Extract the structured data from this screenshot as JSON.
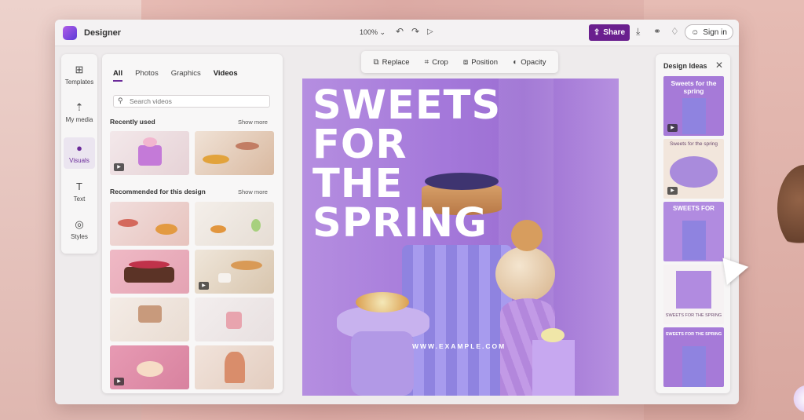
{
  "app": {
    "title": "Designer"
  },
  "titlebar": {
    "zoom": "100%",
    "share_label": "Share",
    "signin_label": "Sign in"
  },
  "rail": {
    "items": [
      {
        "label": "Templates"
      },
      {
        "label": "My media"
      },
      {
        "label": "Visuals",
        "active": true
      },
      {
        "label": "Text"
      },
      {
        "label": "Styles"
      }
    ]
  },
  "panel": {
    "tabs": [
      {
        "label": "All"
      },
      {
        "label": "Photos"
      },
      {
        "label": "Graphics"
      },
      {
        "label": "Videos"
      }
    ],
    "search_placeholder": "Search videos",
    "recent_title": "Recently used",
    "recent_more": "Show more",
    "recommended_title": "Recommended for this design",
    "recommended_more": "Show more"
  },
  "toolbar": {
    "items": [
      {
        "label": "Replace"
      },
      {
        "label": "Crop"
      },
      {
        "label": "Position"
      },
      {
        "label": "Opacity"
      }
    ]
  },
  "canvas": {
    "title_lines": [
      "SWEETS",
      "FOR",
      "THE",
      "SPRING"
    ],
    "url": "WWW.EXAMPLE.COM"
  },
  "ideas": {
    "title": "Design Ideas",
    "cards": [
      {
        "text": "Sweets for the spring"
      },
      {
        "text": "Sweets for the spring"
      },
      {
        "text": "SWEETS FOR"
      },
      {
        "text": "SWEETS FOR THE SPRING"
      },
      {
        "text": "SWEETS FOR THE SPRING"
      }
    ]
  },
  "colors": {
    "accent": "#6a1f8e",
    "canvas": "#a478da",
    "panel": "#f8f7f7"
  }
}
